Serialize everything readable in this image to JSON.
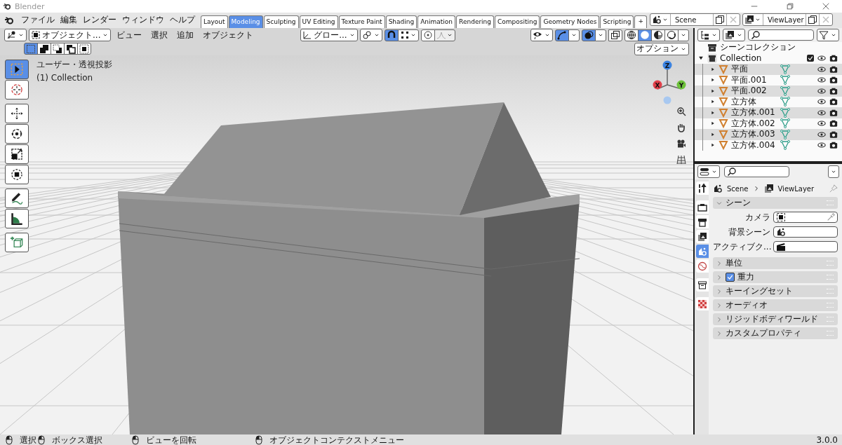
{
  "window": {
    "title": "Blender"
  },
  "menus": [
    "ファイル",
    "編集",
    "レンダー",
    "ウィンドウ",
    "ヘルプ"
  ],
  "workspace_tabs": [
    {
      "label": "Layout",
      "selected": false
    },
    {
      "label": "Modeling",
      "selected": true
    },
    {
      "label": "Sculpting",
      "selected": false
    },
    {
      "label": "UV Editing",
      "selected": false
    },
    {
      "label": "Texture Paint",
      "selected": false
    },
    {
      "label": "Shading",
      "selected": false
    },
    {
      "label": "Animation",
      "selected": false
    },
    {
      "label": "Rendering",
      "selected": false
    },
    {
      "label": "Compositing",
      "selected": false
    },
    {
      "label": "Geometry Nodes",
      "selected": false
    },
    {
      "label": "Scripting",
      "selected": false
    }
  ],
  "add_tab": "+",
  "scene_field": {
    "value": "Scene"
  },
  "view_layer_field": {
    "value": "ViewLayer"
  },
  "viewport_header": {
    "mode": "オブジェクト...",
    "menus": [
      "ビュー",
      "選択",
      "追加",
      "オブジェクト"
    ],
    "orientation": "グロー...",
    "snap_on": true,
    "gizmos_on": true,
    "overlays_on": true,
    "xray_on": false,
    "shading_modes": [
      {
        "kind": "wireframe",
        "selected": false
      },
      {
        "kind": "solid",
        "selected": true
      },
      {
        "kind": "material",
        "selected": false
      },
      {
        "kind": "rendered",
        "selected": false
      }
    ]
  },
  "select_modes": [
    {
      "kind": "set",
      "selected": true
    },
    {
      "kind": "extend",
      "selected": false
    },
    {
      "kind": "subtract",
      "selected": false
    },
    {
      "kind": "invert",
      "selected": false
    },
    {
      "kind": "intersect",
      "selected": false
    }
  ],
  "options_button": "オプション",
  "view_info": [
    "ユーザー・透視投影",
    "(1) Collection"
  ],
  "tool_groups": [
    [
      {
        "kind": "select",
        "selected": true
      },
      {
        "kind": "cursor",
        "selected": false
      }
    ],
    [
      {
        "kind": "move",
        "selected": false
      },
      {
        "kind": "rotate",
        "selected": false
      },
      {
        "kind": "scale",
        "selected": false
      },
      {
        "kind": "transform",
        "selected": false
      }
    ],
    [
      {
        "kind": "annotate",
        "selected": false
      },
      {
        "kind": "measure",
        "selected": false
      }
    ],
    [
      {
        "kind": "add-cube",
        "selected": false
      }
    ]
  ],
  "axis_gizmo": {
    "z": "Z",
    "x": "X",
    "y": "Y"
  },
  "outliner": {
    "root": "シーンコレクション",
    "collection": {
      "label": "Collection",
      "expanded": true,
      "checked": true
    },
    "items": [
      {
        "label": "平面"
      },
      {
        "label": "平面.001"
      },
      {
        "label": "平面.002"
      },
      {
        "label": "立方体"
      },
      {
        "label": "立方体.001"
      },
      {
        "label": "立方体.002"
      },
      {
        "label": "立方体.003"
      },
      {
        "label": "立方体.004"
      }
    ]
  },
  "properties": {
    "breadcrumb": [
      "Scene",
      "ViewLayer"
    ],
    "tabs": [
      {
        "kind": "tool",
        "selected": false
      },
      {
        "kind": "render",
        "selected": false
      },
      {
        "kind": "output",
        "selected": false
      },
      {
        "kind": "view-layer",
        "selected": false
      },
      {
        "kind": "scene",
        "selected": true
      },
      {
        "kind": "world",
        "selected": false
      },
      {
        "kind": "collection",
        "selected": false
      },
      {
        "kind": "texture",
        "selected": false
      }
    ],
    "scene_panel": {
      "title": "シーン",
      "expanded": true,
      "fields": [
        {
          "label": "カメラ",
          "kind": "camera"
        },
        {
          "label": "背景シーン",
          "kind": "scene"
        },
        {
          "label": "アクティブク...",
          "kind": "clip"
        }
      ]
    },
    "sections": [
      {
        "title": "単位",
        "kind": "plain"
      },
      {
        "title": "重力",
        "kind": "checkbox",
        "checked": true
      },
      {
        "title": "キーイングセット",
        "kind": "plain"
      },
      {
        "title": "オーディオ",
        "kind": "plain"
      },
      {
        "title": "リジッドボディワールド",
        "kind": "plain"
      },
      {
        "title": "カスタムプロパティ",
        "kind": "plain"
      }
    ]
  },
  "status_bar": {
    "hints": [
      "選択",
      "ボックス選択",
      "ビューを回転",
      "オブジェクトコンテクストメニュー"
    ],
    "version": "3.0.0"
  }
}
